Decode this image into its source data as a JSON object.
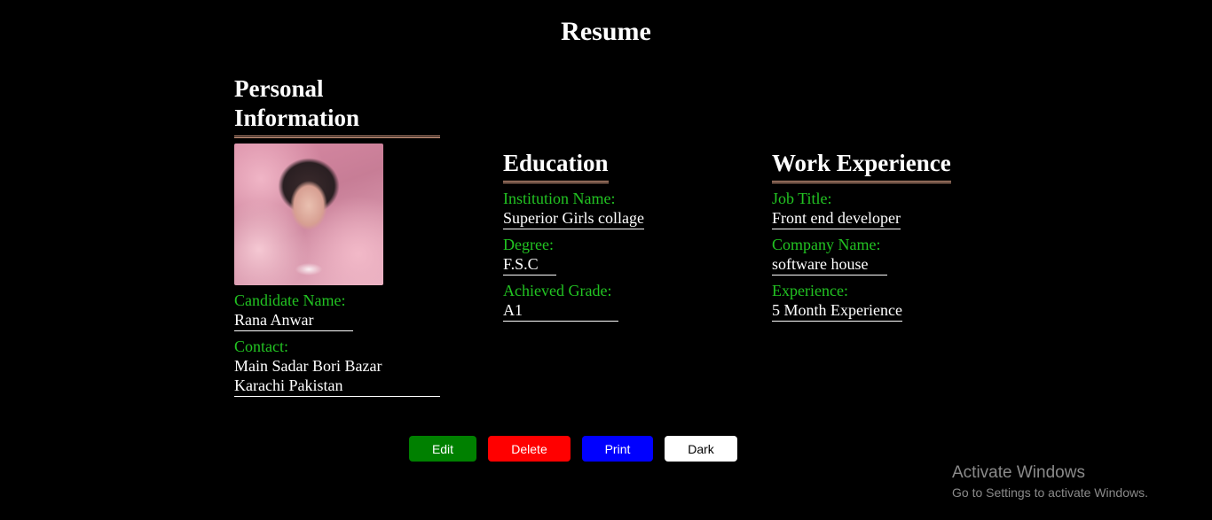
{
  "page": {
    "title": "Resume"
  },
  "personal": {
    "heading_line1": "Personal",
    "heading_line2": "Information",
    "photo_alt": "Candidate photo",
    "name_label": "Candidate Name:",
    "name_value": "Rana Anwar",
    "contact_label": "Contact:",
    "contact_line1": "Main Sadar Bori Bazar",
    "contact_line2": "Karachi Pakistan"
  },
  "education": {
    "heading": "Education",
    "fields": [
      {
        "label": "Institution Name:",
        "value": "Superior Girls collage"
      },
      {
        "label": "Degree:",
        "value": "F.S.C"
      },
      {
        "label": "Achieved Grade:",
        "value": "A1"
      }
    ]
  },
  "work": {
    "heading": "Work Experience",
    "fields": [
      {
        "label": "Job Title:",
        "value": "Front end developer"
      },
      {
        "label": "Company Name:",
        "value": "software house"
      },
      {
        "label": "Experience:",
        "value": "5 Month Experience"
      }
    ]
  },
  "actions": {
    "edit_label": "Edit",
    "delete_label": "Delete",
    "print_label": "Print",
    "dark_label": "Dark"
  },
  "watermark": {
    "title": "Activate Windows",
    "subtitle": "Go to Settings to activate Windows."
  },
  "colors": {
    "label_green": "#22c322",
    "heading_underline": "#e0a58a",
    "edit": "#008000",
    "delete": "#ff0000",
    "print": "#0000ff",
    "dark": "#ffffff"
  }
}
